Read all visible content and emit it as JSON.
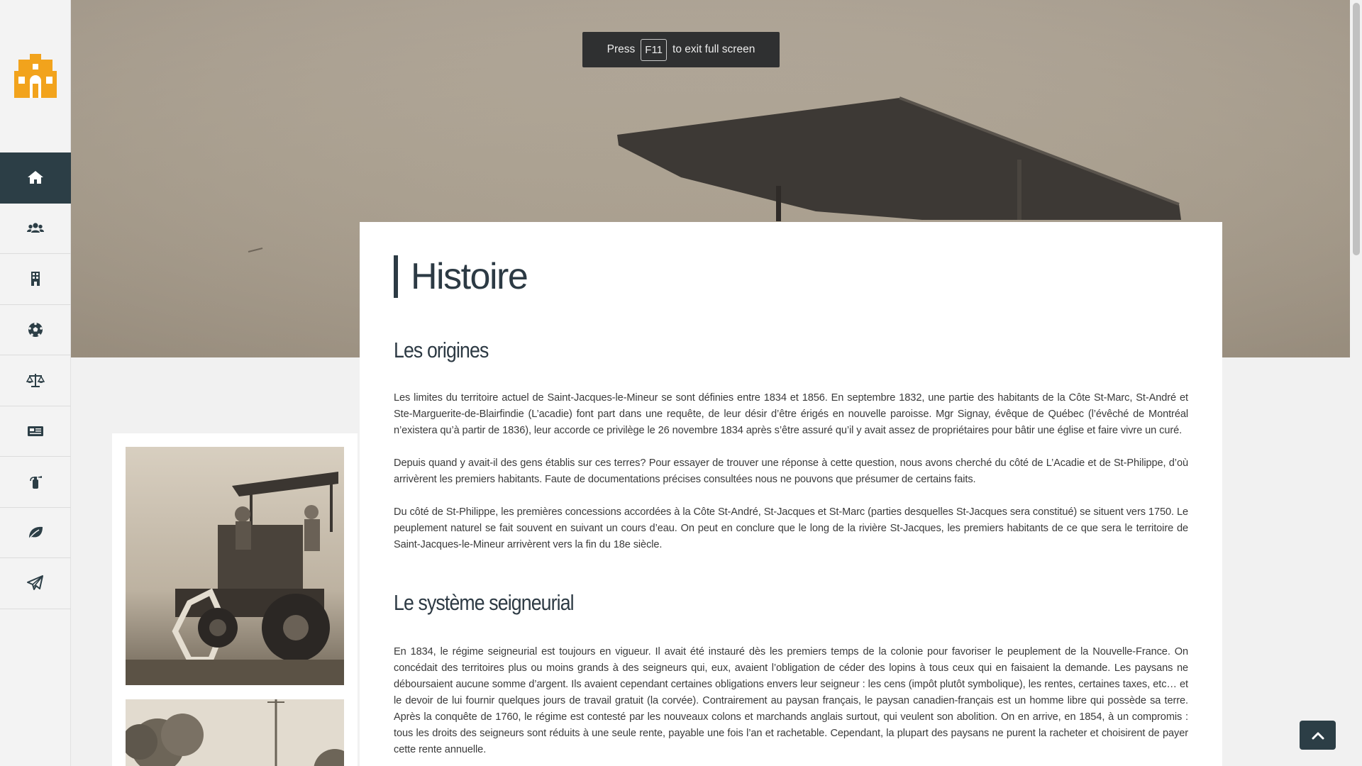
{
  "toast": {
    "before": "Press",
    "key": "F11",
    "after": "to exit full screen"
  },
  "sidebar": {
    "logo": "town-hall-logo",
    "items": [
      {
        "icon": "home-icon",
        "active": true
      },
      {
        "icon": "users-icon",
        "active": false
      },
      {
        "icon": "building-icon",
        "active": false
      },
      {
        "icon": "soccer-ball-icon",
        "active": false
      },
      {
        "icon": "balance-scale-icon",
        "active": false
      },
      {
        "icon": "newspaper-icon",
        "active": false
      },
      {
        "icon": "fire-extinguisher-icon",
        "active": false
      },
      {
        "icon": "leaf-icon",
        "active": false
      },
      {
        "icon": "paper-plane-icon",
        "active": false
      }
    ]
  },
  "main": {
    "title": "Histoire",
    "sections": [
      {
        "heading": "Les origines",
        "paragraphs": [
          "Les limites du territoire actuel de Saint-Jacques-le-Mineur se sont définies entre 1834 et 1856. En septembre 1832, une partie des habitants de la Côte St-Marc, St-André et Ste-Marguerite-de-Blairfindie (L’acadie) font part dans une requête, de leur désir d’être érigés en nouvelle paroisse. Mgr Signay, évêque de Québec (l’évêché de Montréal n’existera qu’à partir de 1836), leur accorde ce privilège le 26 novembre 1834 après s’être assuré qu’il y avait assez de propriétaires pour bâtir une église et faire vivre un curé.",
          "Depuis quand y avait-il des gens établis sur ces terres? Pour essayer de trouver une réponse à cette question, nous avons cherché du côté de L’Acadie et de St-Philippe, d’où arrivèrent les premiers habitants. Faute de documentations précises consultées nous ne pouvons que présumer de certains faits.",
          "Du côté de St-Philippe, les premières concessions accordées à la Côte St-André, St-Jacques et St-Marc (parties desquelles St-Jacques sera constitué) se situent vers 1750. Le peuplement naturel se fait souvent en suivant un cours d’eau. On peut en conclure que le long de la rivière St-Jacques, les premiers habitants de ce que sera le territoire de Saint-Jacques-le-Mineur arrivèrent vers la fin du 18e siècle."
        ]
      },
      {
        "heading": "Le système seigneurial",
        "paragraphs": [
          "En 1834, le régime seigneurial est toujours en vigueur. Il avait été instauré dès les premiers temps de la colonie pour favoriser le peuplement de la Nouvelle-France. On concédait des territoires plus ou moins grands à des seigneurs qui, eux, avaient l’obligation de céder des lopins à tous ceux qui en faisaient la demande. Les paysans ne déboursaient aucune somme d’argent. Ils avaient cependant certaines obligations envers leur seigneur : les cens (impôt plutôt symbolique), les rentes, certaines taxes, etc… et le devoir de lui fournir quelques jours de travail gratuit (la corvée). Contrairement au paysan français, le paysan canadien-français est un homme libre qui possède sa terre. Après la conquête de 1760, le régime est contesté par les nouveaux colons et marchands anglais surtout, qui veulent son abolition. On en arrive, en 1854, à un compromis : tous les droits des seigneurs sont réduits à une seule rente, payable une fois l’an et rachetable. Cependant, la plupart des paysans ne purent la racheter et choisirent de payer cette rente annuelle."
        ]
      }
    ]
  },
  "back_to_top": {
    "icon": "chevron-up-icon"
  },
  "colors": {
    "primary": "#2c3e46",
    "logo": "#f2a31c",
    "sepia": "#aca292"
  }
}
